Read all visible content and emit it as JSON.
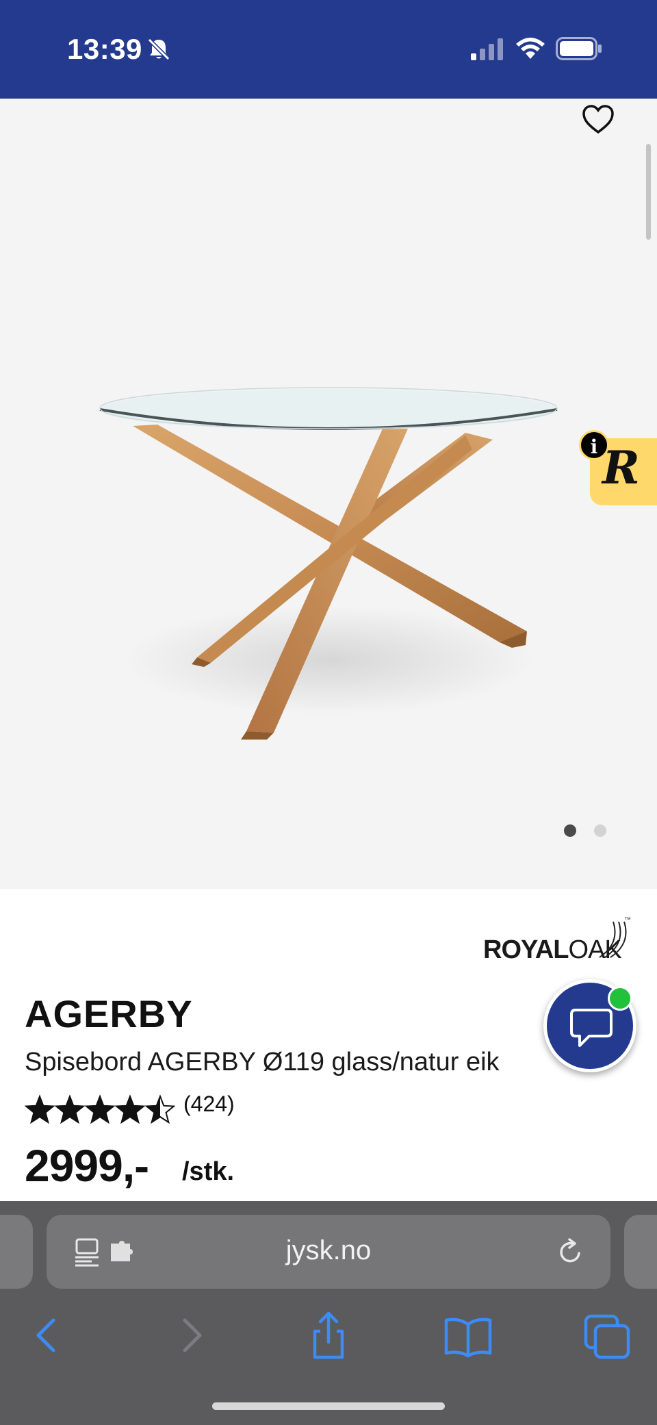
{
  "status_bar": {
    "time": "13:39",
    "icons": [
      "bell-muted-icon",
      "cellular-signal-icon",
      "wifi-icon",
      "battery-icon"
    ],
    "background": "#233a8f"
  },
  "gallery": {
    "favorite_icon": "heart-outline-icon",
    "image_alt": "glass dining table with crossed oak legs",
    "page_count": 2,
    "active_page": 1,
    "badge_letter": "R",
    "badge_info": "i"
  },
  "product": {
    "brand_logo_bold": "ROYAL",
    "brand_logo_light": "OAK",
    "brand_logo_tm": "™",
    "title": "AGERBY",
    "description": "Spisebord AGERBY Ø119 glass/natur eik",
    "rating": 4.5,
    "rating_max": 5,
    "rating_count": "(424)",
    "price": "2999,-",
    "unit": "/stk."
  },
  "chat": {
    "icon": "chat-bubble-icon",
    "status_color": "#1fc23a"
  },
  "browser": {
    "url": "jysk.no",
    "icons": [
      "reader-icon",
      "extension-icon",
      "reload-icon"
    ],
    "nav": [
      "back-icon",
      "forward-icon",
      "share-icon",
      "bookmarks-icon",
      "tabs-icon"
    ]
  }
}
